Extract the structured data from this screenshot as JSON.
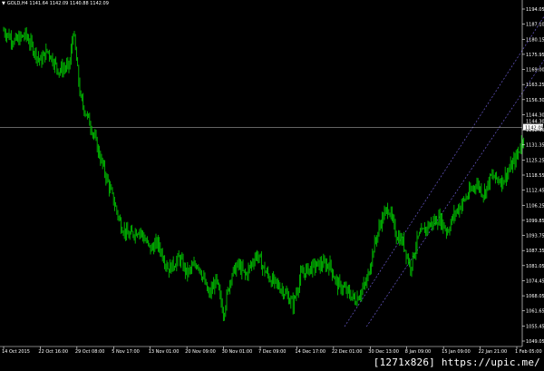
{
  "app": {
    "chart_title": "GOLD,H4 1141.64 1142.09 1140.88 1142.09"
  },
  "watermark": "[1271x826] https://upic.me/",
  "icons": {
    "symbol_marker": "triangle-down-icon"
  },
  "colors": {
    "background": "#000000",
    "candles": "#00c000",
    "channel": "#6a5acd",
    "price_line": "#c8c8c8",
    "axis_text": "#ffffff"
  },
  "price_axis": {
    "labels": [
      "1194.05",
      "1187.10",
      "1180.15",
      "1175.95",
      "1169.00",
      "1163.25",
      "1156.30",
      "1144.30",
      "1138.05",
      "1131.35",
      "1125.25",
      "1118.55",
      "1112.45",
      "1106.25",
      "1099.85",
      "1093.75",
      "1087.35",
      "1081.05",
      "1074.45",
      "1068.05",
      "1061.65",
      "1055.45",
      "1049.05"
    ]
  },
  "current_price": {
    "label": "1142.09",
    "upper_label": "1144.30"
  },
  "time_axis": {
    "labels": [
      "14 Oct 2015",
      "22 Oct 16:00",
      "29 Oct 08:00",
      "5 Nov 17:00",
      "13 Nov 01:00",
      "20 Nov 09:00",
      "30 Nov 01:00",
      "7 Dec 09:00",
      "14 Dec 17:00",
      "22 Dec 01:00",
      "30 Dec 13:00",
      "8 Jan 09:00",
      "15 Jan 09:00",
      "22 Jan 21:00",
      "1 Feb 05:00"
    ]
  },
  "chart_data": {
    "type": "line",
    "symbol": "GOLD",
    "timeframe": "H4",
    "x": [
      "14 Oct 2015",
      "22 Oct 16:00",
      "29 Oct 08:00",
      "5 Nov 17:00",
      "13 Nov 01:00",
      "20 Nov 09:00",
      "30 Nov 01:00",
      "7 Dec 09:00",
      "14 Dec 17:00",
      "22 Dec 01:00",
      "30 Dec 13:00",
      "8 Jan 09:00",
      "15 Jan 09:00",
      "22 Jan 21:00",
      "1 Feb 05:00"
    ],
    "path_points": [
      [
        0,
        1186
      ],
      [
        0.3,
        1181
      ],
      [
        0.6,
        1184
      ],
      [
        1.0,
        1172
      ],
      [
        1.2,
        1177
      ],
      [
        1.5,
        1168
      ],
      [
        1.8,
        1170
      ],
      [
        1.9,
        1186
      ],
      [
        2.1,
        1155
      ],
      [
        2.4,
        1142
      ],
      [
        2.7,
        1125
      ],
      [
        3.0,
        1109
      ],
      [
        3.2,
        1098
      ],
      [
        3.4,
        1093
      ],
      [
        3.7,
        1096
      ],
      [
        4.0,
        1087
      ],
      [
        4.2,
        1090
      ],
      [
        4.5,
        1078
      ],
      [
        4.8,
        1083
      ],
      [
        5.0,
        1076
      ],
      [
        5.3,
        1081
      ],
      [
        5.6,
        1066
      ],
      [
        5.8,
        1073
      ],
      [
        6.0,
        1058
      ],
      [
        6.2,
        1075
      ],
      [
        6.4,
        1080
      ],
      [
        6.6,
        1075
      ],
      [
        6.9,
        1085
      ],
      [
        7.1,
        1078
      ],
      [
        7.3,
        1073
      ],
      [
        7.6,
        1069
      ],
      [
        7.9,
        1062
      ],
      [
        8.1,
        1075
      ],
      [
        8.3,
        1078
      ],
      [
        8.6,
        1080
      ],
      [
        8.9,
        1080
      ],
      [
        9.1,
        1071
      ],
      [
        9.3,
        1069
      ],
      [
        9.6,
        1064
      ],
      [
        9.9,
        1072
      ],
      [
        10.1,
        1088
      ],
      [
        10.3,
        1100
      ],
      [
        10.5,
        1106
      ],
      [
        10.7,
        1094
      ],
      [
        10.9,
        1090
      ],
      [
        11.1,
        1079
      ],
      [
        11.3,
        1092
      ],
      [
        11.6,
        1098
      ],
      [
        11.9,
        1101
      ],
      [
        12.1,
        1095
      ],
      [
        12.3,
        1103
      ],
      [
        12.6,
        1110
      ],
      [
        12.9,
        1117
      ],
      [
        13.1,
        1112
      ],
      [
        13.3,
        1120
      ],
      [
        13.6,
        1118
      ],
      [
        13.8,
        1123
      ],
      [
        14.0,
        1129
      ],
      [
        14.2,
        1139
      ]
    ],
    "channel": {
      "upper": [
        [
          9.3,
          1052
        ],
        [
          15.0,
          1199
        ]
      ],
      "lower": [
        [
          9.9,
          1052
        ],
        [
          15.0,
          1179
        ]
      ]
    },
    "current_price": 1142.09,
    "ylim": [
      1043,
      1199
    ]
  }
}
